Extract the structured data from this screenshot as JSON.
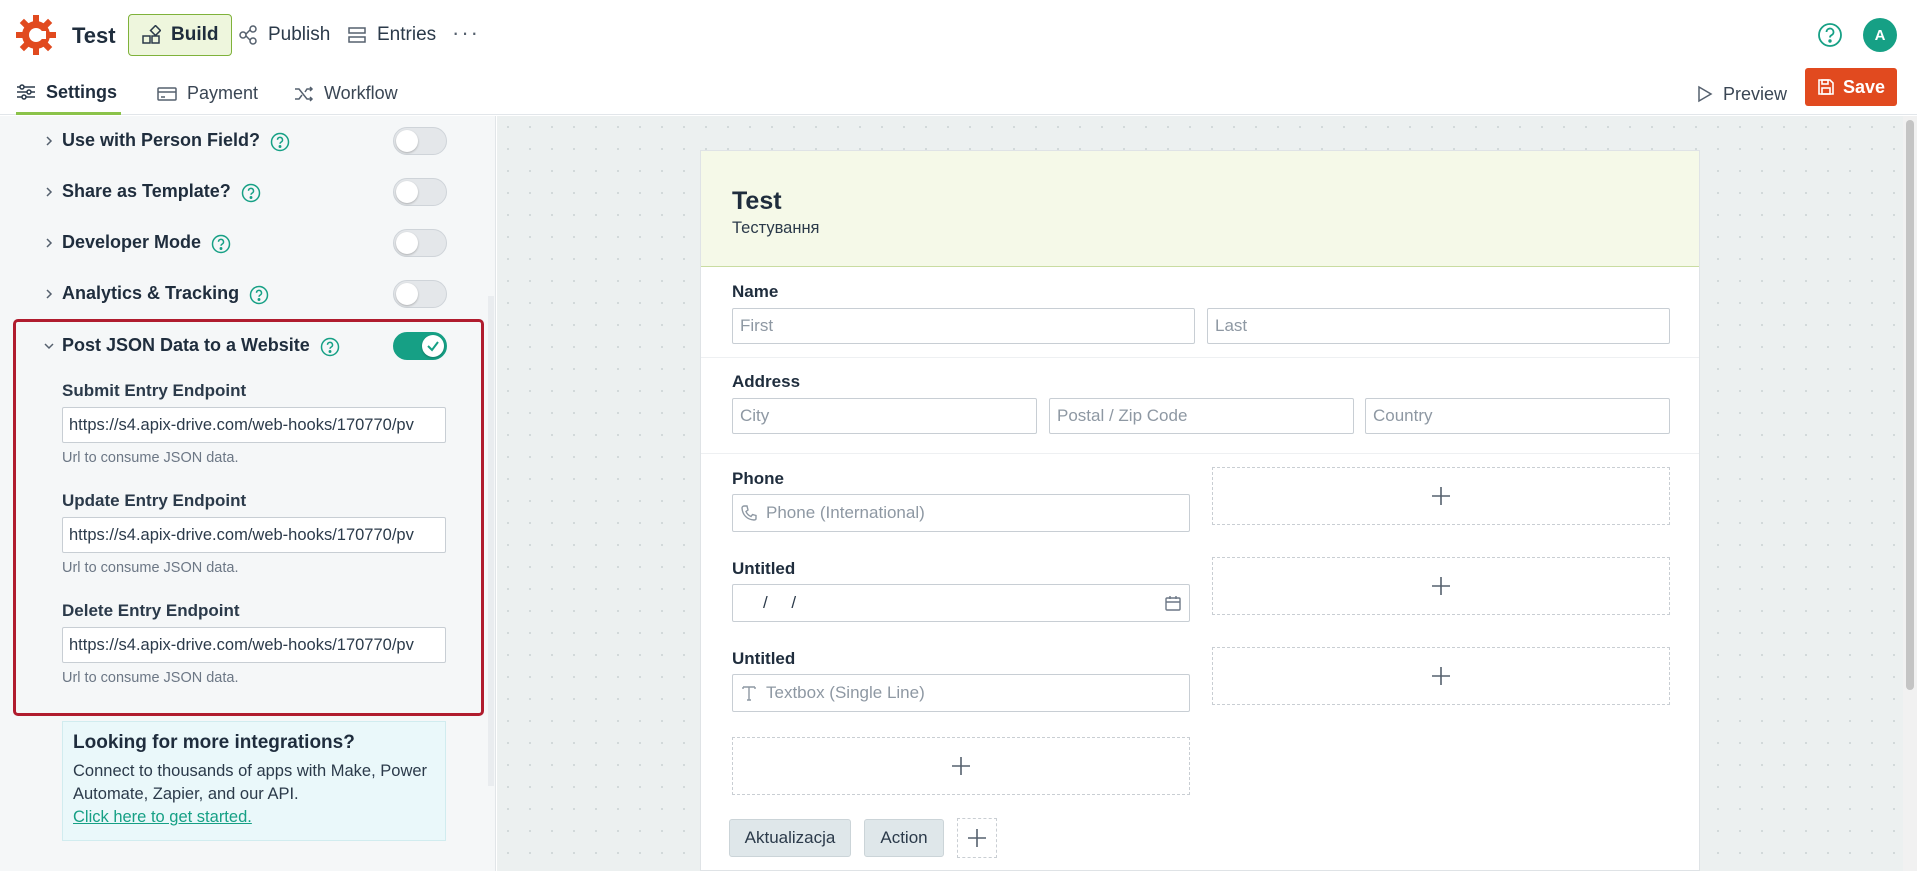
{
  "app": {
    "title": "Test"
  },
  "nav": {
    "build": "Build",
    "publish": "Publish",
    "entries": "Entries",
    "more": "···"
  },
  "user": {
    "avatar_initial": "A"
  },
  "subnav": {
    "settings": "Settings",
    "payment": "Payment",
    "workflow": "Workflow",
    "preview": "Preview",
    "save": "Save"
  },
  "settings": {
    "items": [
      {
        "label": "Use with Person Field?",
        "enabled": false
      },
      {
        "label": "Share as Template?",
        "enabled": false
      },
      {
        "label": "Developer Mode",
        "enabled": false
      },
      {
        "label": "Analytics & Tracking",
        "enabled": false
      },
      {
        "label": "Post JSON Data to a Website",
        "enabled": true
      }
    ],
    "endpoints": [
      {
        "label": "Submit Entry Endpoint",
        "value": "https://s4.apix-drive.com/web-hooks/170770/pv",
        "help": "Url to consume JSON data."
      },
      {
        "label": "Update Entry Endpoint",
        "value": "https://s4.apix-drive.com/web-hooks/170770/pv",
        "help": "Url to consume JSON data."
      },
      {
        "label": "Delete Entry Endpoint",
        "value": "https://s4.apix-drive.com/web-hooks/170770/pv",
        "help": "Url to consume JSON data."
      }
    ],
    "promo": {
      "title": "Looking for more integrations?",
      "text": "Connect to thousands of apps with Make, Power Automate, Zapier, and our API.",
      "link": "Click here to get started."
    }
  },
  "form": {
    "title": "Test",
    "description": "Тестування",
    "fields": {
      "name": {
        "label": "Name",
        "first": "First",
        "last": "Last"
      },
      "address": {
        "label": "Address",
        "city": "City",
        "zip": "Postal / Zip Code",
        "country": "Country"
      },
      "phone": {
        "label": "Phone",
        "placeholder": "Phone (International)"
      },
      "date": {
        "label": "Untitled",
        "placeholder": "/     /"
      },
      "textbox": {
        "label": "Untitled",
        "placeholder": "Textbox (Single Line)"
      }
    },
    "actions": [
      "Aktualizacja",
      "Action"
    ]
  },
  "colors": {
    "accent": "#16a085",
    "save": "#e14a1f",
    "build_active_bg": "#eef6dd",
    "highlight_border": "#b01c2e"
  }
}
